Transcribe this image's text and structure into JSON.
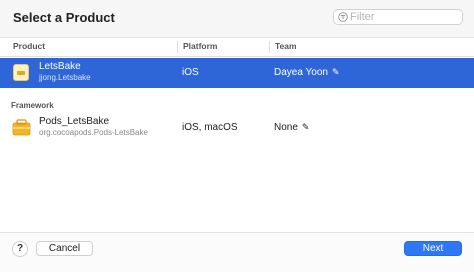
{
  "dialog": {
    "title": "Select a Product",
    "filter_placeholder": "Filter"
  },
  "columns": {
    "product": "Product",
    "platform": "Platform",
    "team": "Team"
  },
  "rows": [
    {
      "name": "LetsBake",
      "subtitle": "jjong.Letsbake",
      "platform": "iOS",
      "team": "Dayea Yoon",
      "selected": true
    }
  ],
  "framework_section": {
    "label": "Framework",
    "rows": [
      {
        "name": "Pods_LetsBake",
        "subtitle": "org.cocoapods.Pods-LetsBake",
        "platform": "iOS, macOS",
        "team": "None"
      }
    ]
  },
  "footer": {
    "help": "?",
    "cancel": "Cancel",
    "next": "Next"
  },
  "colors": {
    "selection": "#2e66d9",
    "primary_button": "#2e77f5"
  },
  "icons": {
    "filter": "filter-icon",
    "app": "app-target-icon",
    "framework": "framework-icon",
    "edit": "pencil-icon"
  }
}
